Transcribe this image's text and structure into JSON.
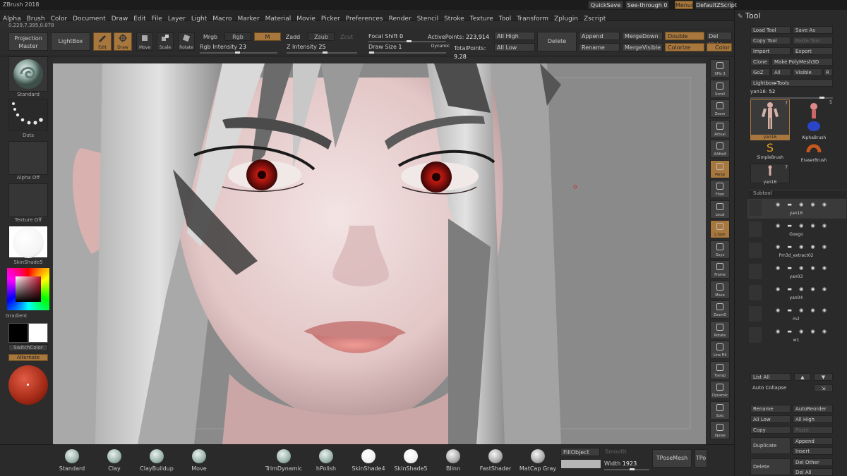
{
  "app": {
    "title": "ZBrush 2018"
  },
  "topright": {
    "quicksave": "QuickSave",
    "seethrough": "See-through",
    "seethrough_value": "0",
    "menus": "Menus",
    "defaultscript": "DefaultZScript"
  },
  "menus": [
    "Alpha",
    "Brush",
    "Color",
    "Document",
    "Draw",
    "Edit",
    "File",
    "Layer",
    "Light",
    "Macro",
    "Marker",
    "Material",
    "Movie",
    "Picker",
    "Preferences",
    "Render",
    "Stencil",
    "Stroke",
    "Texture",
    "Tool",
    "Transform",
    "Zplugin",
    "Zscript"
  ],
  "coords": "0.229,7.395,0.078",
  "toolbar": {
    "projection_master": "Projection Master",
    "lightbox": "LightBox",
    "edit": "Edit",
    "draw": "Draw",
    "move": "Move",
    "scale": "Scale",
    "rotate": "Rotate",
    "mrgb": "Mrgb",
    "rgb": "Rgb",
    "m": "M",
    "rgb_intensity_label": "Rgb Intensity",
    "rgb_intensity": "23",
    "zadd": "Zadd",
    "zsub": "Zsub",
    "zcut": "Zcut",
    "z_intensity_label": "Z Intensity",
    "z_intensity": "25",
    "focal_shift_label": "Focal Shift",
    "focal_shift": "0",
    "draw_size_label": "Draw Size",
    "draw_size": "1",
    "dynamic": "Dynamic",
    "active_points_label": "ActivePoints:",
    "active_points": "223,914",
    "total_points_label": "TotalPoints:",
    "total_points": "9.28",
    "all_high": "All High",
    "all_low": "All Low",
    "delete": "Delete",
    "append": "Append",
    "rename": "Rename",
    "merge_down": "MergeDown",
    "merge_visible": "MergeVisible",
    "double": "Double",
    "colorize": "Colorize",
    "del_hidden": "Del Hidd",
    "color_button": "Color"
  },
  "left_shelf": {
    "brush": "Standard",
    "stroke": "Dots",
    "alpha": "Alpha Off",
    "texture": "Texture Off",
    "material": "SkinShade5",
    "gradient": "Gradient",
    "switch_color": "SwitchColor",
    "alternate": "Alternate"
  },
  "right_shelf": [
    {
      "label": "SPix 3"
    },
    {
      "label": "Scroll"
    },
    {
      "label": "Zoom"
    },
    {
      "label": "Actual"
    },
    {
      "label": "AAHalf"
    },
    {
      "label": "Persp"
    },
    {
      "label": "Floor"
    },
    {
      "label": "Local"
    },
    {
      "label": "L.Sym"
    },
    {
      "label": "Gxyz"
    },
    {
      "label": "Frame"
    },
    {
      "label": "Move"
    },
    {
      "label": "ZoomD"
    },
    {
      "label": "Rotate"
    },
    {
      "label": "Line Fill"
    },
    {
      "label": "Transp"
    },
    {
      "label": "Dynamic"
    },
    {
      "label": "Solo"
    },
    {
      "label": "Xpose"
    }
  ],
  "tool_panel": {
    "title": "Tool",
    "load_tool": "Load Tool",
    "save_as": "Save As",
    "copy_tool": "Copy Tool",
    "paste_tool": "Paste Tool",
    "import": "Import",
    "export": "Export",
    "clone": "Clone",
    "make_polymesh": "Make PolyMesh3D",
    "goz": "GoZ",
    "all": "All",
    "visible": "Visible",
    "r": "R",
    "lightbox_tools": "Lightbox▸Tools",
    "current_tool_label": "yan16:",
    "current_tool_value": "52",
    "thumbs": [
      {
        "name": "yan16",
        "count": "7"
      },
      {
        "name": "AlphaBrush",
        "count": "5"
      },
      {
        "name": "SimpleBrush",
        "count": ""
      },
      {
        "name": "EraserBrush",
        "count": ""
      },
      {
        "name": "yan16",
        "count": "7"
      }
    ],
    "subtool_title": "Subtool",
    "subtools": [
      "yan16",
      "Goego",
      "Pm3d_extract02",
      "yan03",
      "yan04",
      "m2",
      "w1"
    ],
    "list_all": "List All",
    "auto_collapse": "Auto Collapse",
    "rename": "Rename",
    "auto_reorder": "AutoReorder",
    "all_low": "All Low",
    "all_high": "All High",
    "copy": "Copy",
    "paste": "Paste",
    "duplicate": "Duplicate",
    "append": "Append",
    "insert": "Insert",
    "delete": "Delete",
    "del_other": "Del Other",
    "del_all": "Del All"
  },
  "bottom": {
    "brushes": [
      {
        "name": "Standard",
        "style": "teal"
      },
      {
        "name": "Clay",
        "style": "teal"
      },
      {
        "name": "ClayBuildup",
        "style": "teal"
      },
      {
        "name": "Move",
        "style": "teal"
      },
      {
        "name": "TrimDynamic",
        "style": "teal"
      },
      {
        "name": "hPolish",
        "style": "teal"
      },
      {
        "name": "SkinShade4",
        "style": "white"
      },
      {
        "name": "SkinShade5",
        "style": "white"
      },
      {
        "name": "Blinn",
        "style": "gray"
      },
      {
        "name": "FastShader",
        "style": "gray"
      },
      {
        "name": "MatCap Gray",
        "style": "gray"
      }
    ],
    "fill_object": "FillObject",
    "smooth_label": "Smooth",
    "width_label": "Width",
    "width_value": "1923",
    "tpose_mesh": "TPoseMesh",
    "tpo": "TPo"
  },
  "colors": {
    "accent": "#a8773d",
    "panel": "#2c2c2c",
    "viewport_bg": "#8c8c8c"
  }
}
